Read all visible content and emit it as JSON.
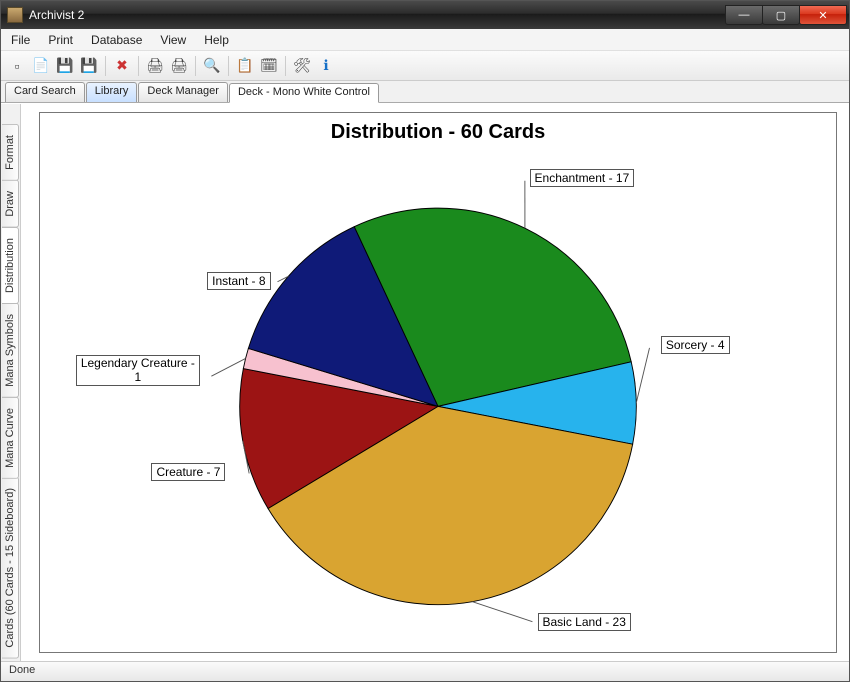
{
  "window": {
    "title": "Archivist 2"
  },
  "menubar": {
    "items": [
      "File",
      "Print",
      "Database",
      "View",
      "Help"
    ]
  },
  "toolbar": {
    "icons": [
      {
        "name": "new-icon",
        "glyph": "▫"
      },
      {
        "name": "open-icon",
        "glyph": "📄"
      },
      {
        "name": "save-icon",
        "glyph": "💾"
      },
      {
        "name": "save-all-icon",
        "glyph": "💾"
      },
      {
        "name": "delete-icon",
        "glyph": "✖"
      },
      {
        "name": "print-icon",
        "glyph": "🖨"
      },
      {
        "name": "print-preview-icon",
        "glyph": "🖨"
      },
      {
        "name": "search-icon",
        "glyph": "🔍"
      },
      {
        "name": "copy-icon",
        "glyph": "📋"
      },
      {
        "name": "calendar-icon",
        "glyph": "🗓"
      },
      {
        "name": "tools-icon",
        "glyph": "🛠"
      },
      {
        "name": "info-icon",
        "glyph": "ℹ"
      }
    ]
  },
  "top_tabs": {
    "items": [
      {
        "label": "Card Search",
        "active": false
      },
      {
        "label": "Library",
        "active": false,
        "variant": "library"
      },
      {
        "label": "Deck Manager",
        "active": false
      },
      {
        "label": "Deck - Mono White Control",
        "active": true
      }
    ]
  },
  "side_tabs": {
    "items": [
      {
        "label": "Format",
        "active": false
      },
      {
        "label": "Draw",
        "active": false
      },
      {
        "label": "Distribution",
        "active": true
      },
      {
        "label": "Mana Symbols",
        "active": false
      },
      {
        "label": "Mana Curve",
        "active": false
      },
      {
        "label": "Cards (60 Cards - 15 Sideboard)",
        "active": false
      }
    ]
  },
  "statusbar": {
    "text": "Done"
  },
  "chart_data": {
    "type": "pie",
    "title": "Distribution - 60 Cards",
    "total": 60,
    "series": [
      {
        "name": "Enchantment",
        "value": 17,
        "color": "#1a8a1d"
      },
      {
        "name": "Sorcery",
        "value": 4,
        "color": "#27b3ed"
      },
      {
        "name": "Basic Land",
        "value": 23,
        "color": "#d9a431"
      },
      {
        "name": "Creature",
        "value": 7,
        "color": "#9c1414"
      },
      {
        "name": "Legendary Creature",
        "value": 1,
        "color": "#f7c1cf"
      },
      {
        "name": "Instant",
        "value": 8,
        "color": "#0f1a78"
      }
    ],
    "labels": {
      "Enchantment": "Enchantment - 17",
      "Sorcery": "Sorcery - 4",
      "Basic Land": "Basic Land - 23",
      "Creature": "Creature - 7",
      "Legendary Creature": "Legendary Creature -\n1",
      "Instant": "Instant - 8"
    }
  }
}
